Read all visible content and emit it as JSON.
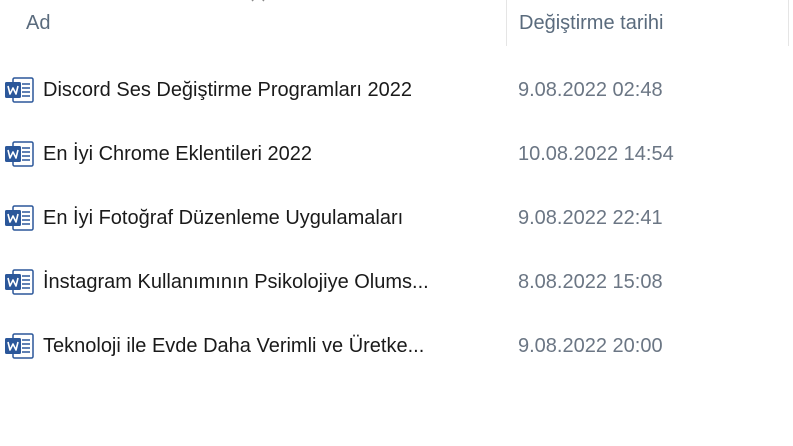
{
  "columns": {
    "name": "Ad",
    "modified": "Değiştirme tarihi"
  },
  "icons": {
    "sort": "chevron-up-icon",
    "file": "word-document-icon"
  },
  "colors": {
    "word_blue": "#2b579a",
    "header_text": "#5a6b7d",
    "date_text": "#6b7684"
  },
  "files": [
    {
      "name": "Discord Ses Değiştirme Programları 2022",
      "modified": "9.08.2022 02:48"
    },
    {
      "name": "En İyi Chrome Eklentileri 2022",
      "modified": "10.08.2022 14:54"
    },
    {
      "name": "En İyi Fotoğraf Düzenleme Uygulamaları",
      "modified": "9.08.2022 22:41"
    },
    {
      "name": "İnstagram Kullanımının Psikolojiye Olums...",
      "modified": "8.08.2022 15:08"
    },
    {
      "name": "Teknoloji ile Evde Daha Verimli ve Üretke...",
      "modified": "9.08.2022 20:00"
    }
  ]
}
